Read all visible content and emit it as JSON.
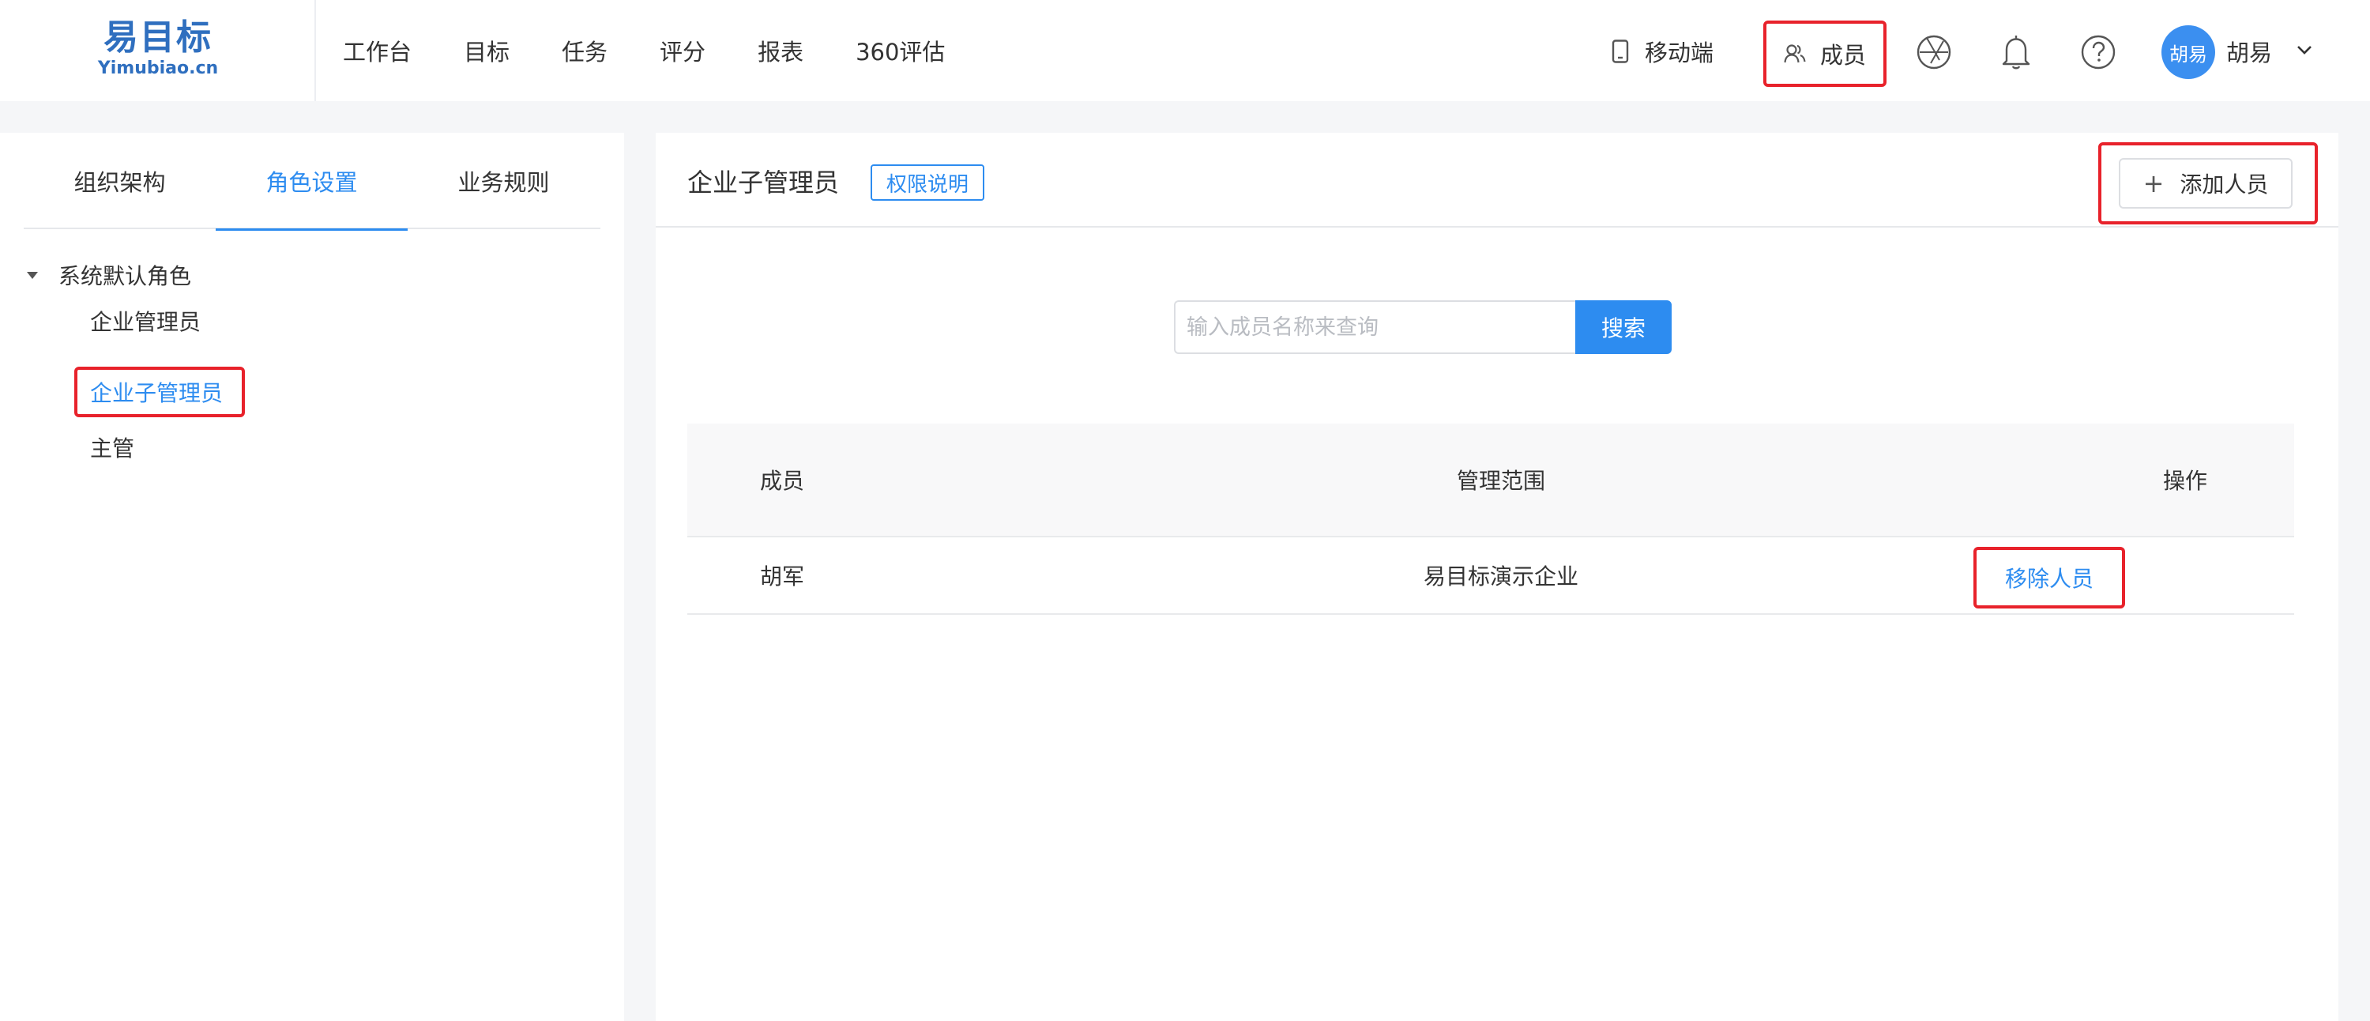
{
  "logo": {
    "cn": "易目标",
    "en": "Yimubiao.cn"
  },
  "nav": {
    "items": [
      {
        "label": "工作台"
      },
      {
        "label": "目标"
      },
      {
        "label": "任务"
      },
      {
        "label": "评分"
      },
      {
        "label": "报表"
      },
      {
        "label": "360评估"
      }
    ]
  },
  "header_right": {
    "mobile_label": "移动端",
    "members_label": "成员",
    "icons": [
      "aperture-icon",
      "bell-icon",
      "help-icon"
    ],
    "avatar_text": "胡易",
    "username": "胡易"
  },
  "left_panel": {
    "tabs": [
      {
        "label": "组织架构",
        "active": false
      },
      {
        "label": "角色设置",
        "active": true
      },
      {
        "label": "业务规则",
        "active": false
      }
    ],
    "tree": {
      "group_label": "系统默认角色",
      "items": [
        {
          "label": "企业管理员",
          "selected": false
        },
        {
          "label": "企业子管理员",
          "selected": true
        },
        {
          "label": "主管",
          "selected": false
        }
      ]
    }
  },
  "main": {
    "title": "企业子管理员",
    "permission_badge": "权限说明",
    "add_button": "添加人员",
    "search": {
      "placeholder": "输入成员名称来查询",
      "value": "",
      "button": "搜索"
    },
    "table": {
      "columns": [
        "成员",
        "管理范围",
        "操作"
      ],
      "rows": [
        {
          "member": "胡军",
          "scope": "易目标演示企业",
          "action": "移除人员"
        }
      ]
    }
  },
  "colors": {
    "accent": "#2d8cf0",
    "highlight_box": "#e8222b",
    "avatar": "#3b8ff0"
  }
}
